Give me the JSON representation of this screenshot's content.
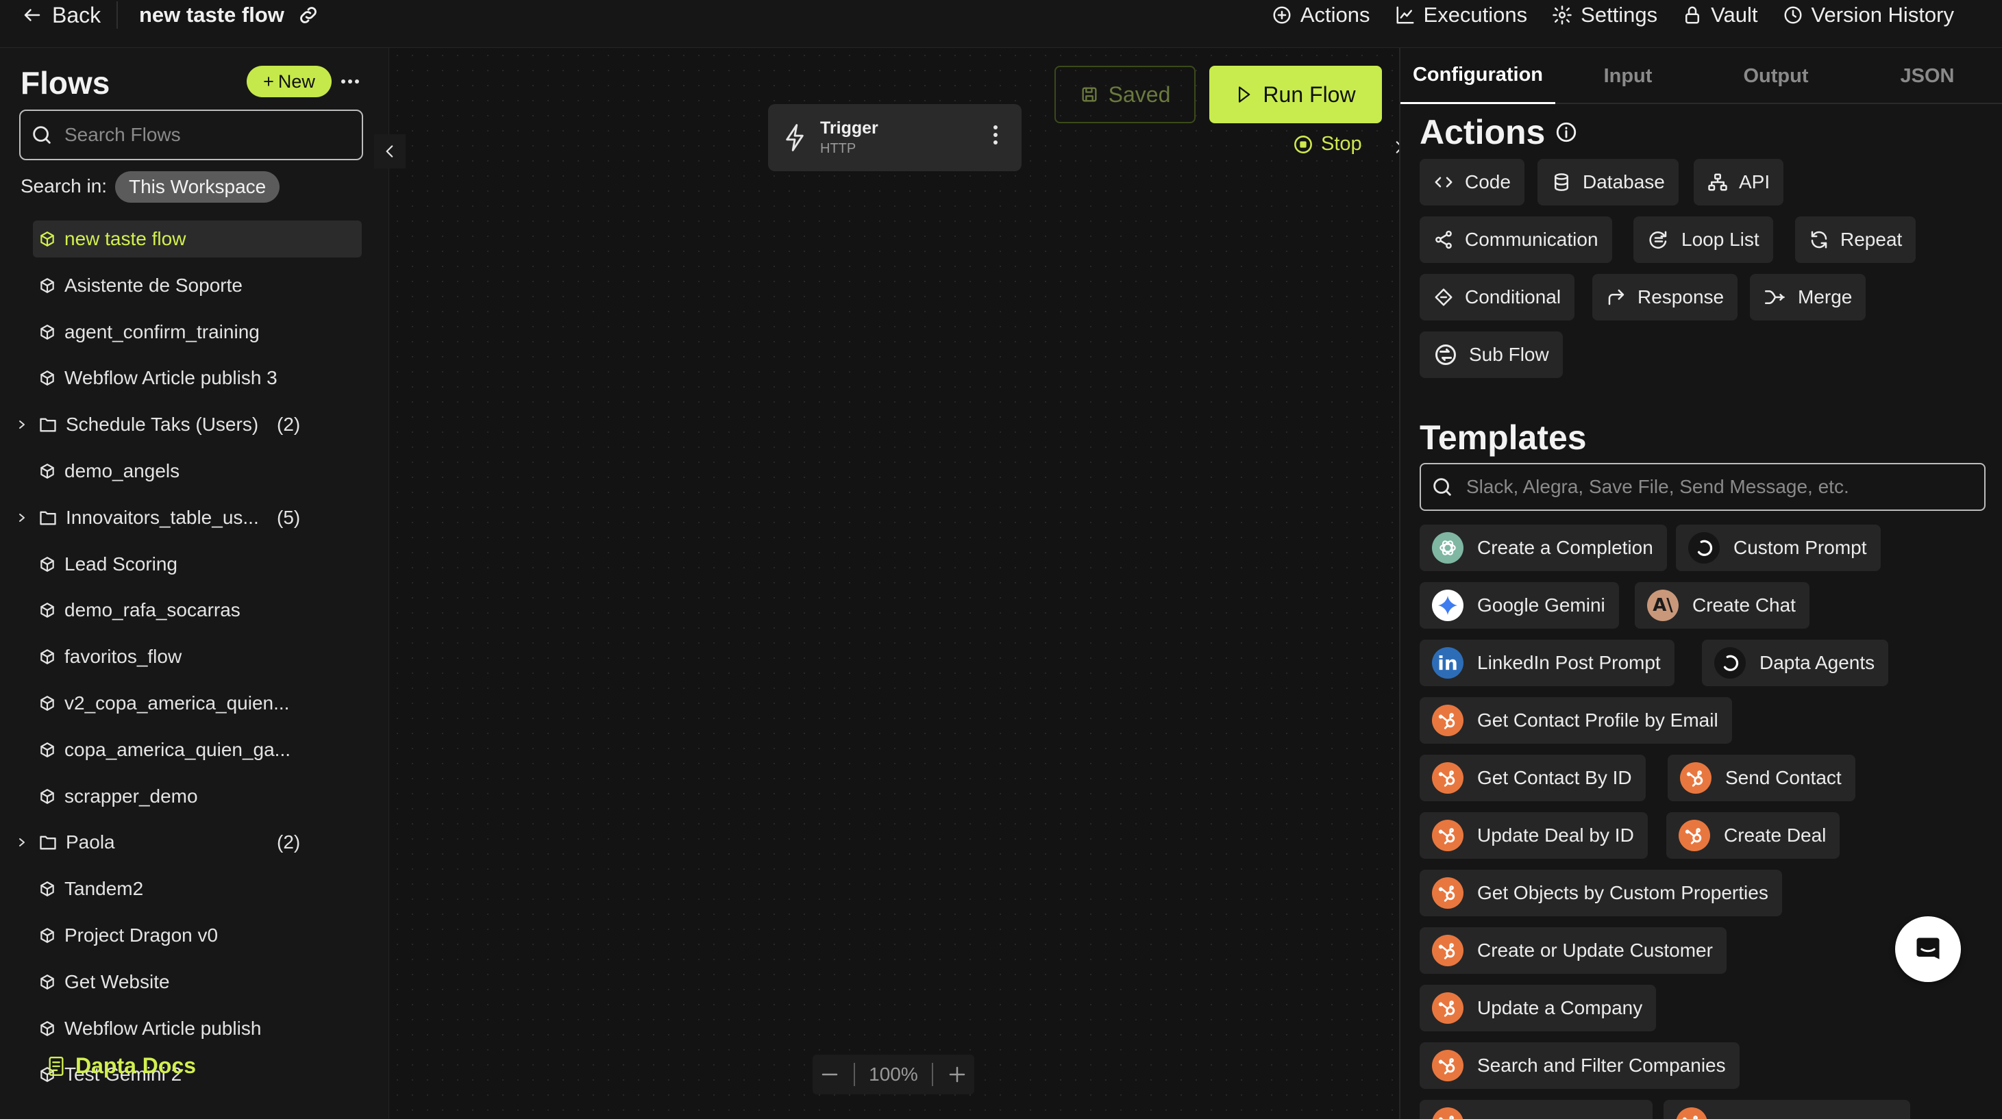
{
  "topbar": {
    "back_label": "Back",
    "flow_title": "new taste flow",
    "nav": [
      {
        "label": "Actions",
        "icon": "plus-circle-icon"
      },
      {
        "label": "Executions",
        "icon": "chart-line-icon"
      },
      {
        "label": "Settings",
        "icon": "gear-icon"
      },
      {
        "label": "Vault",
        "icon": "lock-icon"
      },
      {
        "label": "Version History",
        "icon": "clock-icon"
      }
    ]
  },
  "sidebar": {
    "title": "Flows",
    "new_label": "New",
    "search_placeholder": "Search Flows",
    "search_in_label": "Search in:",
    "workspace_chip": "This Workspace",
    "items": [
      {
        "label": "new taste flow",
        "type": "flow",
        "active": true
      },
      {
        "label": "Asistente de Soporte",
        "type": "flow"
      },
      {
        "label": "agent_confirm_training",
        "type": "flow"
      },
      {
        "label": "Webflow Article publish 3",
        "type": "flow"
      },
      {
        "label": "Schedule Taks (Users)",
        "type": "folder",
        "count": "(2)"
      },
      {
        "label": "demo_angels",
        "type": "flow"
      },
      {
        "label": "Innovaitors_table_us...",
        "type": "folder",
        "count": "(5)"
      },
      {
        "label": "Lead Scoring",
        "type": "flow"
      },
      {
        "label": "demo_rafa_socarras",
        "type": "flow"
      },
      {
        "label": "favoritos_flow",
        "type": "flow"
      },
      {
        "label": "v2_copa_america_quien...",
        "type": "flow"
      },
      {
        "label": "copa_america_quien_ga...",
        "type": "flow"
      },
      {
        "label": "scrapper_demo",
        "type": "flow"
      },
      {
        "label": "Paola",
        "type": "folder",
        "count": "(2)"
      },
      {
        "label": "Tandem2",
        "type": "flow"
      },
      {
        "label": "Project Dragon v0",
        "type": "flow"
      },
      {
        "label": "Get Website",
        "type": "flow"
      },
      {
        "label": "Webflow Article publish",
        "type": "flow"
      },
      {
        "label": "Test Gemini 2",
        "type": "flow"
      }
    ],
    "docs_label": "Dapta Docs"
  },
  "canvas": {
    "trigger": {
      "title": "Trigger",
      "subtitle": "HTTP"
    },
    "saved_label": "Saved",
    "run_label": "Run Flow",
    "stop_label": "Stop",
    "zoom": "100%"
  },
  "panel": {
    "tabs": [
      "Configuration",
      "Input",
      "Output",
      "JSON"
    ],
    "active_tab": "Configuration",
    "actions_title": "Actions",
    "actions": [
      {
        "label": "Code",
        "icon": "code-icon"
      },
      {
        "label": "Database",
        "icon": "database-icon"
      },
      {
        "label": "API",
        "icon": "api-network-icon"
      },
      {
        "label": "Communication",
        "icon": "share-icon"
      },
      {
        "label": "Loop List",
        "icon": "loop-list-icon"
      },
      {
        "label": "Repeat",
        "icon": "repeat-icon"
      },
      {
        "label": "Conditional",
        "icon": "diamond-icon"
      },
      {
        "label": "Response",
        "icon": "reply-arrow-icon"
      },
      {
        "label": "Merge",
        "icon": "merge-icon"
      },
      {
        "label": "Sub Flow",
        "icon": "sub-flow-icon"
      }
    ],
    "templates_title": "Templates",
    "templates_placeholder": "Slack, Alegra, Save File, Send Message, etc.",
    "templates": [
      {
        "label": "Create a Completion",
        "logo": "openai-logo-icon",
        "color": "#7fb7a3"
      },
      {
        "label": "Custom Prompt",
        "logo": "dapta-logo-icon"
      },
      {
        "label": "Google Gemini",
        "logo": "gemini-logo-icon"
      },
      {
        "label": "Create Chat",
        "logo": "anthropic-logo-icon",
        "logo_text": "A\\",
        "color": "#c9987a"
      },
      {
        "label": "LinkedIn Post Prompt",
        "logo": "linkedin-logo-icon",
        "logo_text": "in",
        "color": "#2d6db8"
      },
      {
        "label": "Dapta Agents",
        "logo": "dapta-logo-icon"
      },
      {
        "label": "Get Contact Profile by Email",
        "logo": "hubspot-logo-icon",
        "color": "#e8773f"
      },
      {
        "label": "Get Contact By ID",
        "logo": "hubspot-logo-icon"
      },
      {
        "label": "Send Contact",
        "logo": "hubspot-logo-icon"
      },
      {
        "label": "Update Deal by ID",
        "logo": "hubspot-logo-icon"
      },
      {
        "label": "Create Deal",
        "logo": "hubspot-logo-icon"
      },
      {
        "label": "Get Objects by Custom Properties",
        "logo": "hubspot-logo-icon"
      },
      {
        "label": "Create or Update Customer",
        "logo": "hubspot-logo-icon"
      },
      {
        "label": "Update a Company",
        "logo": "hubspot-logo-icon"
      },
      {
        "label": "Search and Filter Companies",
        "logo": "hubspot-logo-icon"
      }
    ]
  },
  "colors": {
    "accent": "#c8ec4e",
    "accent_text": "#d2f050",
    "background": "#141414",
    "chip": "#262626"
  }
}
